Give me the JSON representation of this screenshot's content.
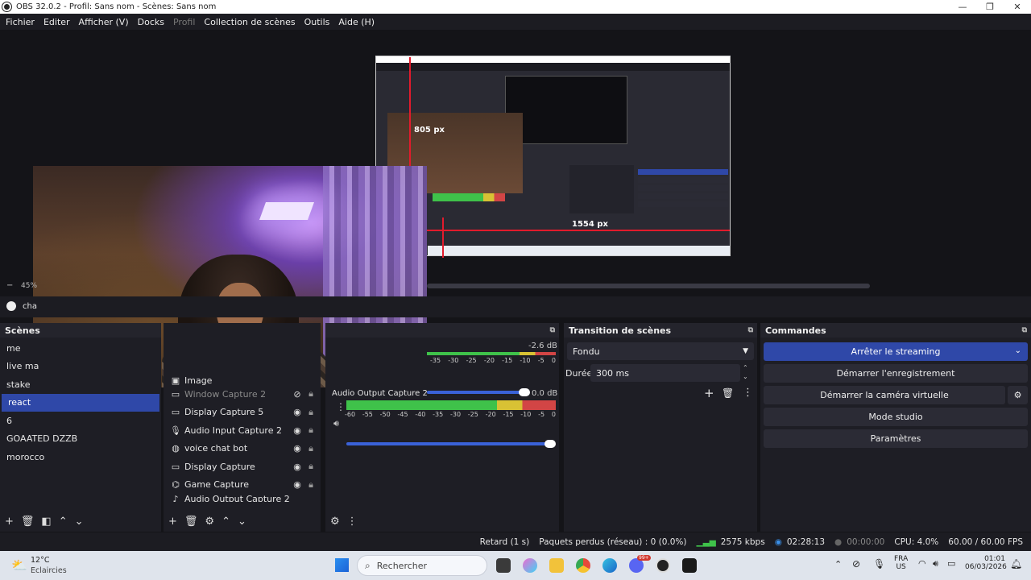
{
  "window": {
    "title": "OBS 32.0.2 - Profil: Sans nom - Scènes: Sans nom",
    "min": "—",
    "max": "❐",
    "close": "✕"
  },
  "menu": [
    "Fichier",
    "Editer",
    "Afficher (V)",
    "Docks",
    "Profil",
    "Collection de scènes",
    "Outils",
    "Aide (H)"
  ],
  "preview": {
    "label_vertical": "805 px",
    "label_horizontal": "1554 px",
    "zoom": "45%",
    "source_name_partial": "cha"
  },
  "scenes": {
    "title": "Scènes",
    "items": [
      "me",
      "live ma",
      "stake",
      "react",
      "6",
      "GOAATED DZZB",
      "morocco"
    ],
    "selected": "react"
  },
  "sources": {
    "items": [
      {
        "name": "Image",
        "icon": "image-icon",
        "dim": false,
        "hidden": false
      },
      {
        "name": "Window Capture 2",
        "icon": "window-icon",
        "dim": true,
        "hidden": true
      },
      {
        "name": "Display Capture 5",
        "icon": "monitor-icon",
        "dim": false,
        "hidden": false
      },
      {
        "name": "Audio Input Capture 2",
        "icon": "mic-icon",
        "dim": false,
        "hidden": false
      },
      {
        "name": "voice chat bot",
        "icon": "browser-icon",
        "dim": false,
        "hidden": false
      },
      {
        "name": "Display Capture",
        "icon": "monitor-icon",
        "dim": false,
        "hidden": false
      },
      {
        "name": "Game Capture",
        "icon": "gamepad-icon",
        "dim": false,
        "hidden": false
      },
      {
        "name": "Audio Output Capture 2",
        "icon": "speaker-icon",
        "dim": false,
        "hidden": false
      }
    ]
  },
  "mixer": {
    "channel1": {
      "db": "-2.6 dB",
      "scale": [
        "-35",
        "-30",
        "-25",
        "-20",
        "-15",
        "-10",
        "-5",
        "0"
      ]
    },
    "channel2": {
      "name": "Audio Output Capture 2",
      "db": "0.0 dB",
      "scale": [
        "-60",
        "-55",
        "-50",
        "-45",
        "-40",
        "-35",
        "-30",
        "-25",
        "-20",
        "-15",
        "-10",
        "-5",
        "0"
      ]
    }
  },
  "transitions": {
    "title": "Transition de scènes",
    "selected": "Fondu",
    "duration_label": "Durée",
    "duration_value": "300 ms"
  },
  "commands": {
    "title": "Commandes",
    "buttons": [
      "Arrêter le streaming",
      "Démarrer l'enregistrement",
      "Démarrer la caméra virtuelle",
      "Mode studio",
      "Paramètres"
    ]
  },
  "status": {
    "delay": "Retard (1 s)",
    "dropped": "Paquets perdus (réseau) : 0 (0.0%)",
    "bitrate": "2575 kbps",
    "stream_time": "02:28:13",
    "rec_time": "00:00:00",
    "cpu": "CPU: 4.0%",
    "fps": "60.00 / 60.00 FPS"
  },
  "taskbar": {
    "weather_temp": "12°C",
    "weather_desc": "Eclaircies",
    "search": "Rechercher",
    "lang1": "FRA",
    "lang2": "US",
    "time": "01:01",
    "date": "06/03/2026",
    "notif_count": "99+"
  },
  "colors": {
    "accent": "#2f48a8",
    "red_guide": "#e21b2c"
  }
}
